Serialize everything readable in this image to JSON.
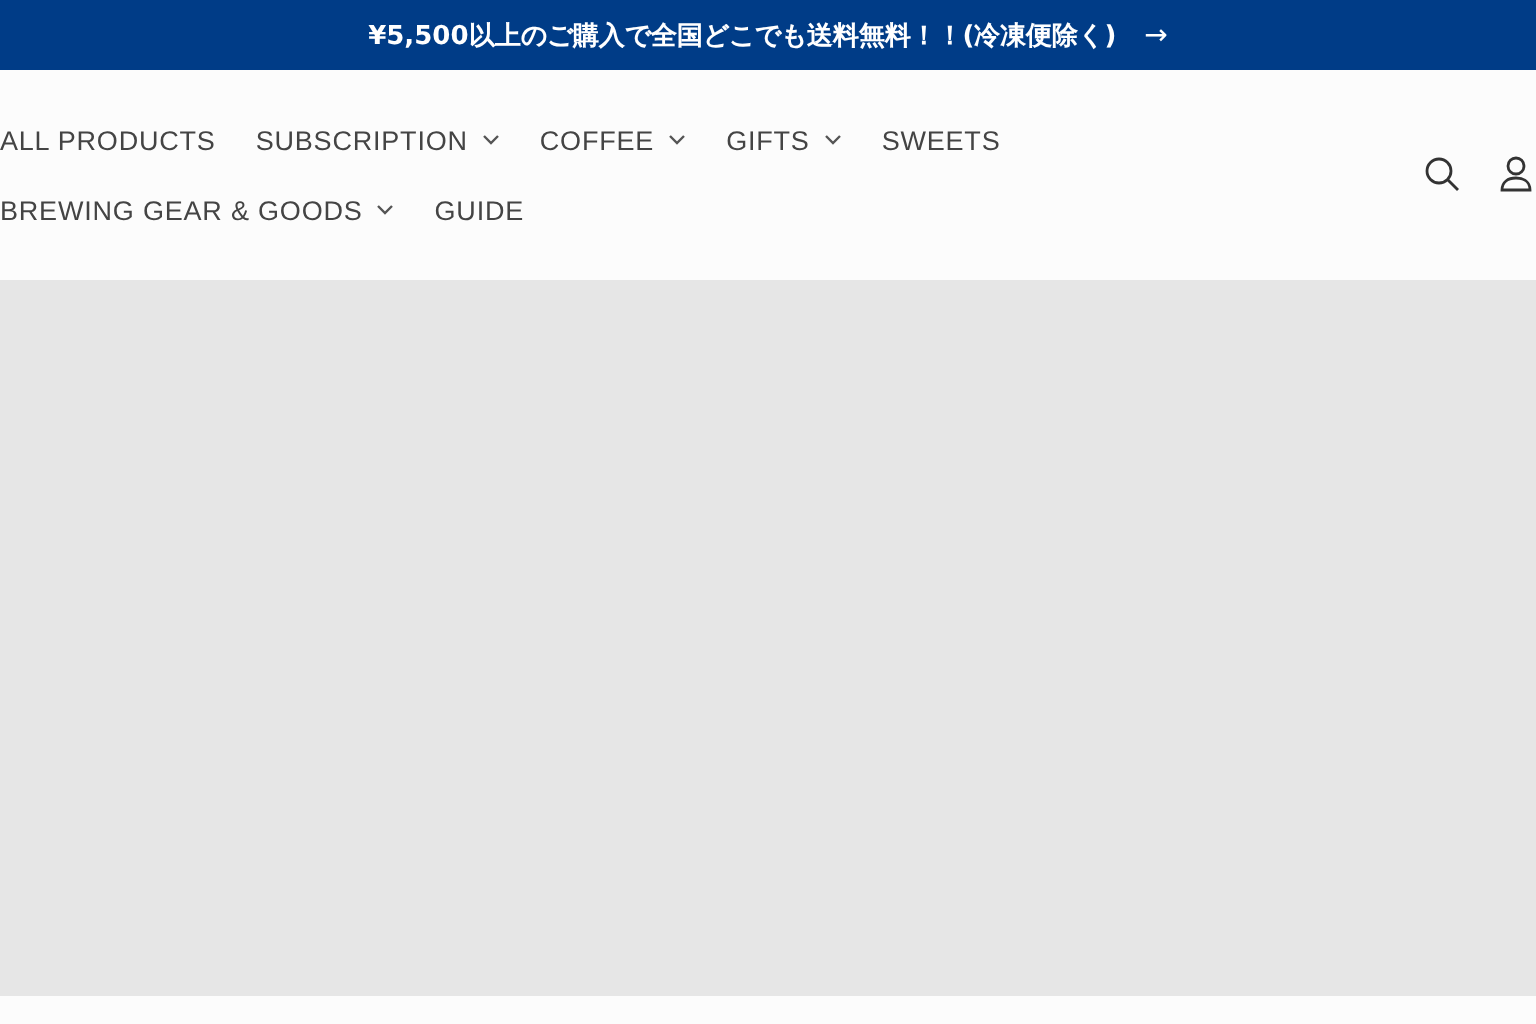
{
  "announcement": {
    "text": "¥5,500以上のご購入で全国どこでも送料無料！！(冷凍便除く)",
    "arrow": "→"
  },
  "nav": {
    "items": [
      {
        "label": "ALL PRODUCTS",
        "dropdown": false
      },
      {
        "label": "SUBSCRIPTION",
        "dropdown": true
      },
      {
        "label": "COFFEE",
        "dropdown": true
      },
      {
        "label": "GIFTS",
        "dropdown": true
      },
      {
        "label": "SWEETS",
        "dropdown": false
      },
      {
        "label": "BREWING GEAR & GOODS",
        "dropdown": true
      },
      {
        "label": "GUIDE",
        "dropdown": false
      }
    ]
  },
  "hero": {
    "kind": "placeholder"
  }
}
